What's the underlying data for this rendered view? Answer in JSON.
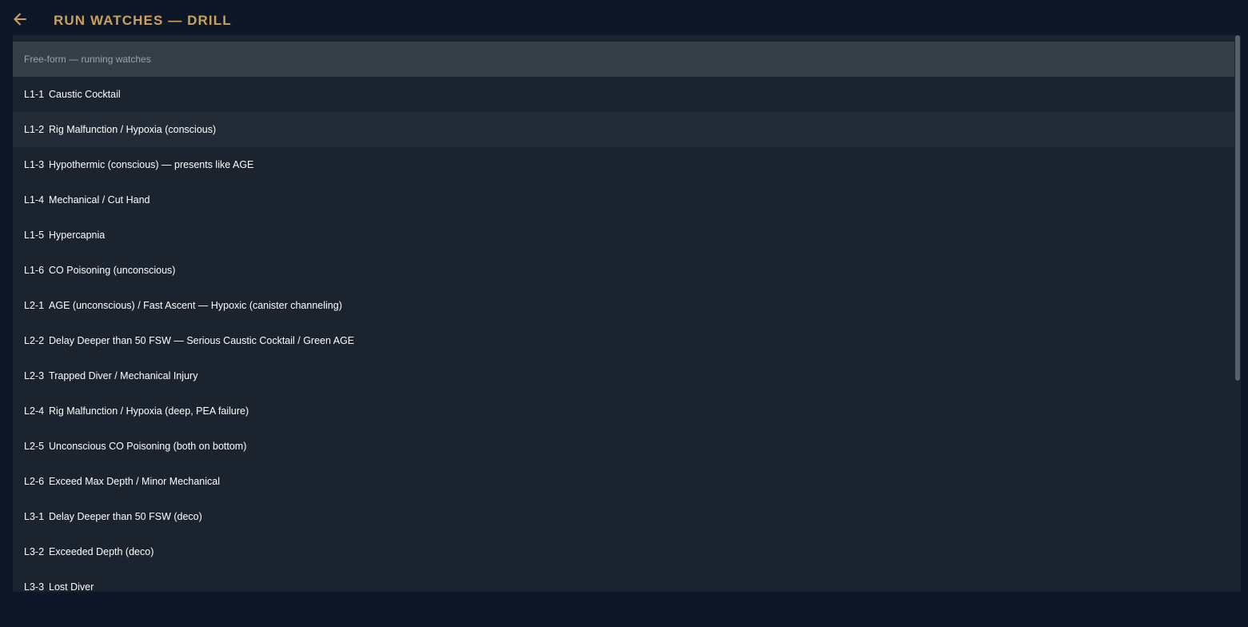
{
  "header": {
    "title": "RUN WATCHES — DRILL",
    "back_icon": "arrow-left-icon",
    "accent_color": "#c9a15b"
  },
  "list": {
    "section_label": "Free-form — running watches",
    "items": [
      {
        "code": "L1-1",
        "label": "Caustic Cocktail"
      },
      {
        "code": "L1-2",
        "label": "Rig Malfunction / Hypoxia (conscious)"
      },
      {
        "code": "L1-3",
        "label": "Hypothermic (conscious) — presents like AGE"
      },
      {
        "code": "L1-4",
        "label": "Mechanical / Cut Hand"
      },
      {
        "code": "L1-5",
        "label": "Hypercapnia"
      },
      {
        "code": "L1-6",
        "label": "CO Poisoning (unconscious)"
      },
      {
        "code": "L2-1",
        "label": "AGE (unconscious) / Fast Ascent — Hypoxic (canister channeling)"
      },
      {
        "code": "L2-2",
        "label": "Delay Deeper than 50 FSW — Serious Caustic Cocktail / Green AGE"
      },
      {
        "code": "L2-3",
        "label": "Trapped Diver / Mechanical Injury"
      },
      {
        "code": "L2-4",
        "label": "Rig Malfunction / Hypoxia (deep, PEA failure)"
      },
      {
        "code": "L2-5",
        "label": "Unconscious CO Poisoning (both on bottom)"
      },
      {
        "code": "L2-6",
        "label": "Exceed Max Depth / Minor Mechanical"
      },
      {
        "code": "L3-1",
        "label": "Delay Deeper than 50 FSW (deco)"
      },
      {
        "code": "L3-2",
        "label": "Exceeded Depth (deco)"
      },
      {
        "code": "L3-3",
        "label": "Lost Diver"
      }
    ]
  }
}
